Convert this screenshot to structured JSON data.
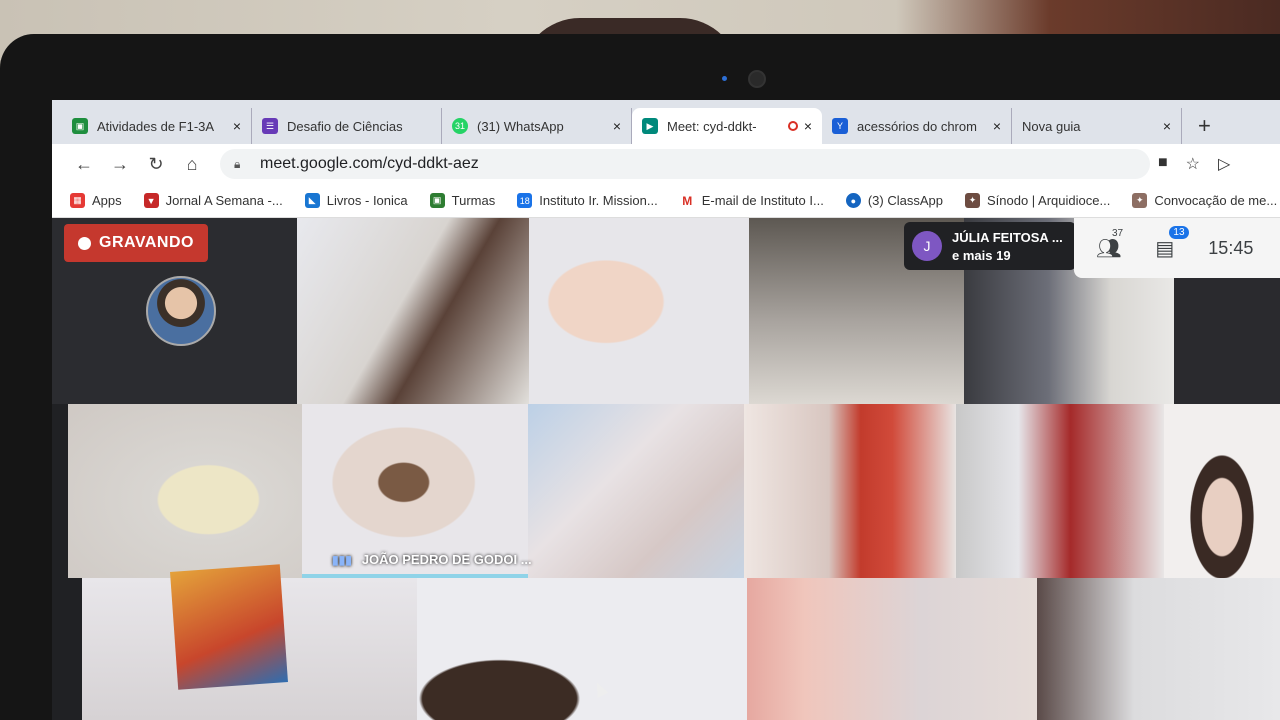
{
  "browser": {
    "tabs": [
      {
        "title": "Atividades de F1-3A",
        "favicon": "classroom-icon",
        "color": "#1e8e3e",
        "glyph": "▣"
      },
      {
        "title": "Desafio de Ciências",
        "favicon": "forms-icon",
        "color": "#673ab7",
        "glyph": "☰"
      },
      {
        "title": "(31) WhatsApp",
        "favicon": "whatsapp-icon",
        "color": "#25d366",
        "glyph": "31"
      },
      {
        "title": "Meet: cyd-ddkt-",
        "favicon": "meet-icon",
        "color": "#00897b",
        "glyph": "▶"
      },
      {
        "title": "acessórios do chrom",
        "favicon": "yahoo-icon",
        "color": "#1a5fd6",
        "glyph": "Y"
      },
      {
        "title": "Nova guia",
        "favicon": "none",
        "color": "#ffffff",
        "glyph": ""
      }
    ],
    "new_tab_label": "+",
    "close_label": "×",
    "url": "meet.google.com/cyd-ddkt-aez",
    "nav": {
      "back": "←",
      "forward": "→",
      "reload": "↻",
      "home": "⌂"
    },
    "toolbar_icons": {
      "camera": "■",
      "star": "☆",
      "extension": "▷"
    }
  },
  "bookmarks": [
    {
      "label": "Apps",
      "icon": "apps-grid-icon",
      "color": "#555555",
      "glyph": "⋮"
    },
    {
      "label": "Jornal A Semana -...",
      "icon": "jornal-icon",
      "color": "#c62828",
      "glyph": "▼"
    },
    {
      "label": "Livros - Ionica",
      "icon": "livros-icon",
      "color": "#1976d2",
      "glyph": "◣"
    },
    {
      "label": "Turmas",
      "icon": "turmas-icon",
      "color": "#2e7d32",
      "glyph": "▣"
    },
    {
      "label": "Instituto Ir. Mission...",
      "icon": "calendar-icon",
      "color": "#1a73e8",
      "glyph": "18"
    },
    {
      "label": "E-mail de Instituto I...",
      "icon": "gmail-icon",
      "color": "#d93025",
      "glyph": "M"
    },
    {
      "label": "(3) ClassApp",
      "icon": "classapp-icon",
      "color": "#1565c0",
      "glyph": "●"
    },
    {
      "label": "Sínodo | Arquidioce...",
      "icon": "sinodo-icon",
      "color": "#6d4c41",
      "glyph": "✦"
    },
    {
      "label": "Convocação de me...",
      "icon": "convocacao-icon",
      "color": "#8d6e63",
      "glyph": "✦"
    }
  ],
  "meet": {
    "recording_label": "GRAVANDO",
    "presenter_initial": "J",
    "presenter_name": "JÚLIA FEITOSA ...",
    "presenter_more": "e mais 19",
    "participants_count": "37",
    "chat_count": "13",
    "time": "15:45",
    "speaking_name": "JOÃO PEDRO DE GODOI ...",
    "participant_icon": "people-icon",
    "chat_icon": "chat-icon"
  }
}
